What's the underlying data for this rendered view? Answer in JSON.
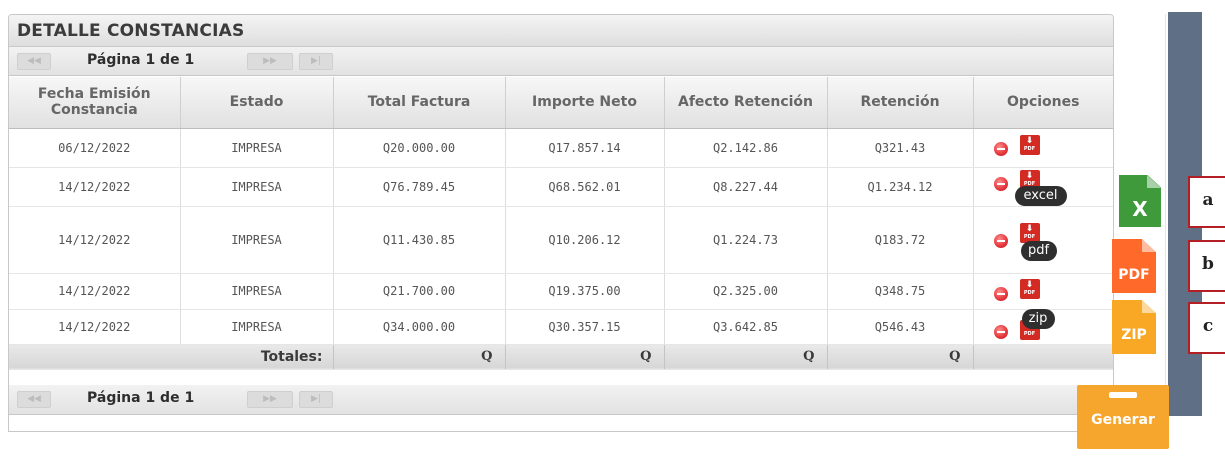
{
  "panel": {
    "title": "DETALLE CONSTANCIAS",
    "pager_top": {
      "text": "Página 1 de 1",
      "first": "◀◀",
      "prev": "◀",
      "next": "▶▶",
      "last": "▶|"
    },
    "pager_bottom": {
      "text": "Página 1 de 1"
    }
  },
  "table": {
    "headers": {
      "fecha": "Fecha Emisión Constancia",
      "estado": "Estado",
      "total": "Total Factura",
      "neto": "Importe Neto",
      "afecto": "Afecto Retención",
      "retencion": "Retención",
      "opciones": "Opciones"
    },
    "rows": [
      {
        "fecha": "06/12/2022",
        "estado": "IMPRESA",
        "total": "Q20.000.00",
        "neto": "Q17.857.14",
        "afecto": "Q2.142.86",
        "retencion": "Q321.43"
      },
      {
        "fecha": "14/12/2022",
        "estado": "IMPRESA",
        "total": "Q76.789.45",
        "neto": "Q68.562.01",
        "afecto": "Q8.227.44",
        "retencion": "Q1.234.12"
      },
      {
        "fecha": "14/12/2022",
        "estado": "IMPRESA",
        "total": "Q11.430.85",
        "neto": "Q10.206.12",
        "afecto": "Q1.224.73",
        "retencion": "Q183.72"
      },
      {
        "fecha": "14/12/2022",
        "estado": "IMPRESA",
        "total": "Q21.700.00",
        "neto": "Q19.375.00",
        "afecto": "Q2.325.00",
        "retencion": "Q348.75"
      },
      {
        "fecha": "14/12/2022",
        "estado": "IMPRESA",
        "total": "Q34.000.00",
        "neto": "Q30.357.15",
        "afecto": "Q3.642.85",
        "retencion": "Q546.43"
      }
    ],
    "totals": {
      "label": "Totales:",
      "total": "Q",
      "neto": "Q",
      "afecto": "Q",
      "retencion": "Q"
    },
    "pdf_icon_label": "PDF"
  },
  "bubbles": {
    "excel": "excel",
    "pdf": "pdf",
    "zip": "zip"
  },
  "tiles": {
    "excel": "X",
    "pdf": "PDF",
    "zip": "ZIP"
  },
  "labels": {
    "a": "a",
    "b": "b",
    "c": "c"
  },
  "generar": {
    "label": "Generar"
  },
  "colors": {
    "excel": "#3f9a3c",
    "pdf": "#ff6a2b",
    "zip": "#f9a825",
    "generar": "#f7a62d",
    "sidebar": "#5f6f85",
    "label_border": "#b41e25"
  }
}
